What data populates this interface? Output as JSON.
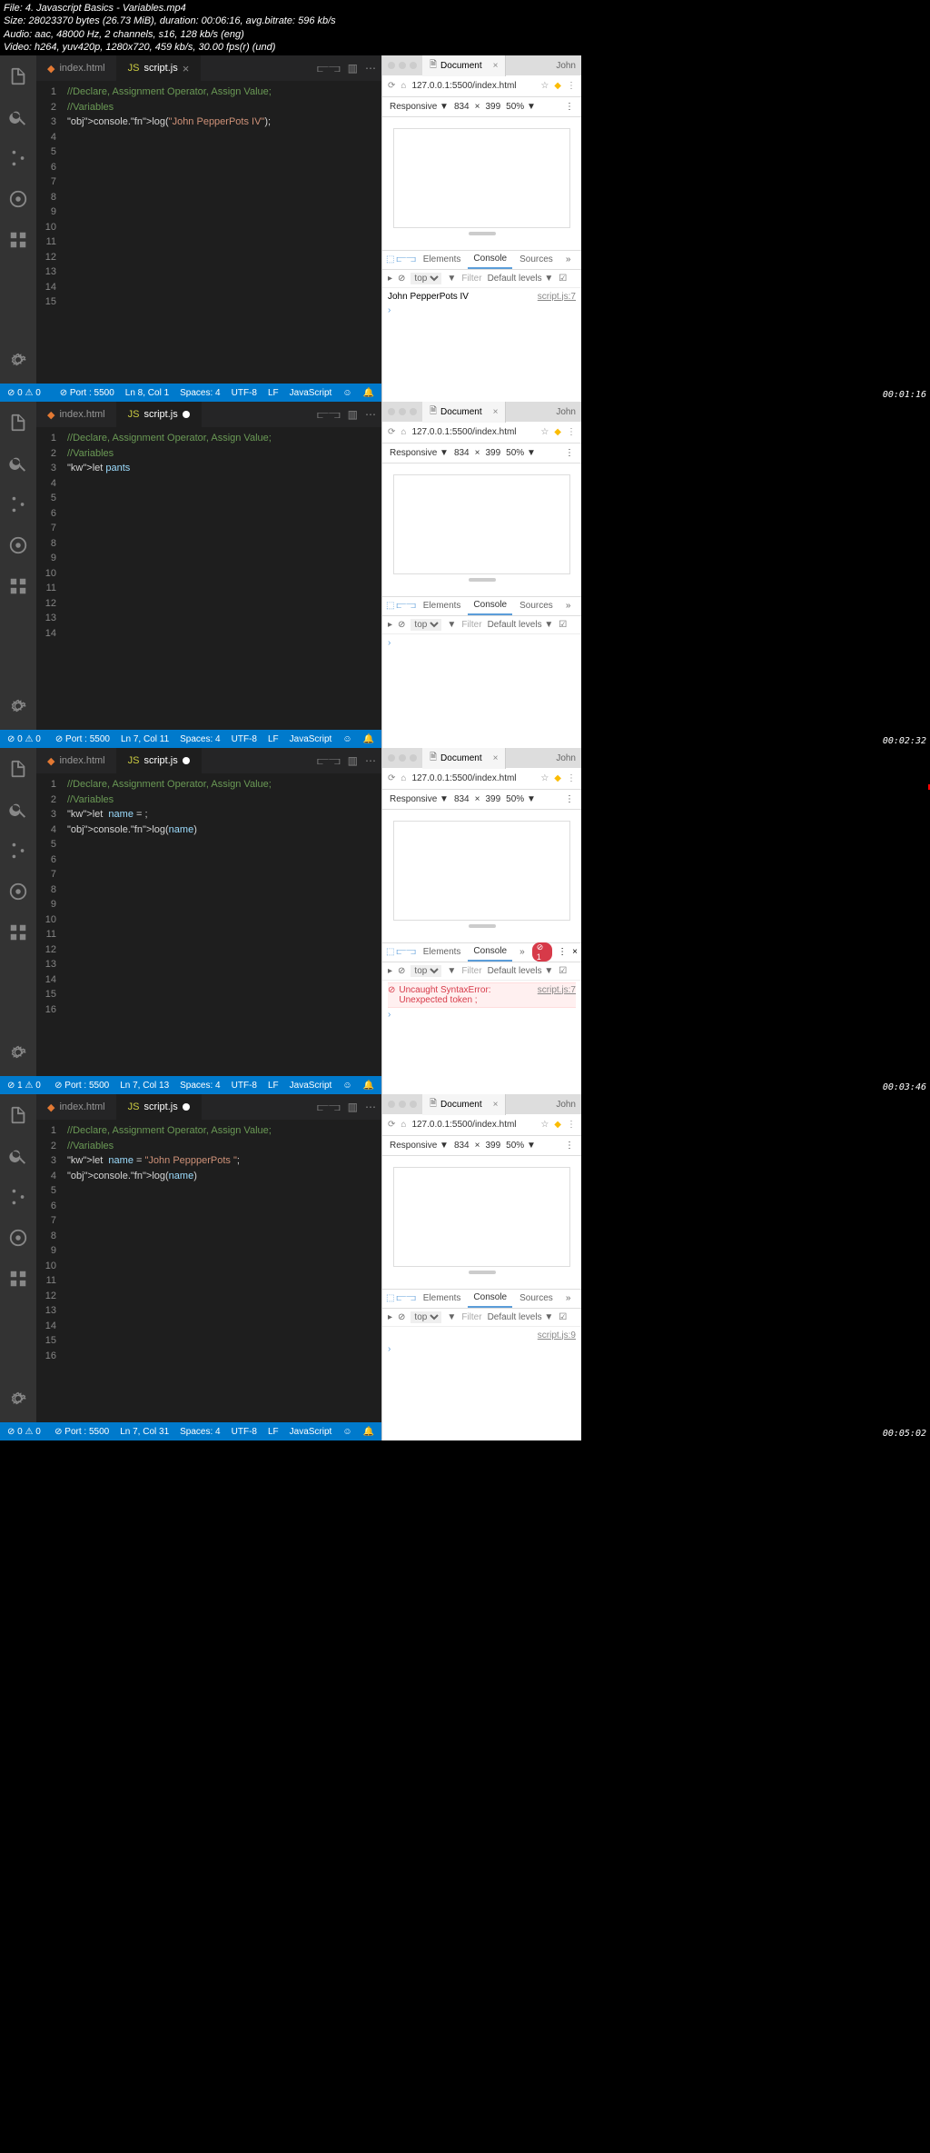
{
  "meta": {
    "file": "File: 4. Javascript Basics  - Variables.mp4",
    "size": "Size: 28023370 bytes (26.73 MiB), duration: 00:06:16, avg.bitrate: 596 kb/s",
    "audio": "Audio: aac, 48000 Hz, 2 channels, s16, 128 kb/s (eng)",
    "video": "Video: h264, yuv420p, 1280x720, 459 kb/s, 30.00 fps(r) (und)"
  },
  "common": {
    "tab_index": "index.html",
    "tab_script": "script.js",
    "doc_tab": "Document",
    "user": "John",
    "url": "127.0.0.1:5500/index.html",
    "responsive": "Responsive",
    "vw": "834",
    "vh": "399",
    "zoom": "50%",
    "dev_elements": "Elements",
    "dev_console": "Console",
    "dev_sources": "Sources",
    "top": "top",
    "filter": "Filter",
    "default_levels": "Default levels",
    "port": "Port : 5500",
    "spaces": "Spaces: 4",
    "enc": "UTF-8",
    "eol": "LF",
    "lang": "JavaScript"
  },
  "frames": [
    {
      "ts": "00:01:16",
      "status_err": "0",
      "status_warn": "0",
      "status_info": "0",
      "cursor": "Ln 8, Col 1",
      "lines": [
        "",
        "//Declare, Assignment Operator, Assign Value;",
        "",
        "//Variables",
        "",
        "",
        "console.log(\"John PepperPots IV\");",
        ""
      ],
      "line_count": 15,
      "console_out": [
        {
          "text": "John PepperPots IV",
          "src": "script.js:7"
        }
      ],
      "has_sources": true
    },
    {
      "ts": "00:02:32",
      "status_err": "0",
      "status_warn": "0",
      "status_info": "0",
      "cursor": "Ln 7, Col 11",
      "lines": [
        "",
        "//Declare, Assignment Operator, Assign Value;",
        "",
        "//Variables",
        "",
        "",
        "let pants "
      ],
      "line_count": 14,
      "console_out": [],
      "has_sources": true
    },
    {
      "ts": "00:03:46",
      "status_err": "1",
      "status_warn": "0",
      "status_info": "0",
      "cursor": "Ln 7, Col 13",
      "lines": [
        "",
        "//Declare, Assignment Operator, Assign Value;",
        "",
        "//Variables",
        "",
        "",
        "let  name = ;",
        "",
        "console.log(name)"
      ],
      "line_count": 16,
      "console_err": {
        "text": "Uncaught SyntaxError: Unexpected token ;",
        "src": "script.js:7"
      },
      "err_count": "1",
      "has_sources": false,
      "has_redline": true
    },
    {
      "ts": "00:05:02",
      "status_err": "0",
      "status_warn": "0",
      "status_info": "0",
      "cursor": "Ln 7, Col 31",
      "lines": [
        "",
        "//Declare, Assignment Operator, Assign Value;",
        "",
        "//Variables",
        "",
        "",
        "let  name = \"John PeppperPots \";",
        "",
        "console.log(name)"
      ],
      "line_count": 16,
      "console_out": [
        {
          "text": "",
          "src": "script.js:9"
        }
      ],
      "has_sources": true
    }
  ]
}
